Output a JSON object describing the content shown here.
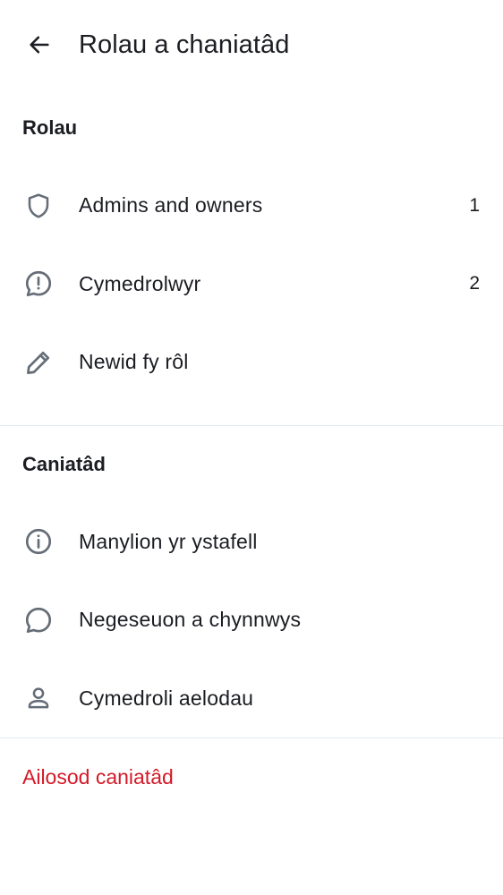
{
  "header": {
    "title": "Rolau a chaniatâd",
    "back_icon": "arrow-left-icon"
  },
  "roles_section": {
    "title": "Rolau",
    "items": [
      {
        "label": "Admins and owners",
        "count": "1",
        "icon": "shield-icon"
      },
      {
        "label": "Cymedrolwyr",
        "count": "2",
        "icon": "chat-alert-icon"
      },
      {
        "label": "Newid fy rôl",
        "count": "",
        "icon": "pencil-icon"
      }
    ]
  },
  "permissions_section": {
    "title": "Caniatâd",
    "items": [
      {
        "label": "Manylion yr ystafell",
        "icon": "info-icon"
      },
      {
        "label": "Negeseuon a chynnwys",
        "icon": "chat-bubble-icon"
      },
      {
        "label": "Cymedroli aelodau",
        "icon": "user-icon"
      }
    ]
  },
  "reset": {
    "label": "Ailosod caniatâd",
    "color": "#d51928"
  },
  "colors": {
    "text": "#1b1d22",
    "icon": "#656d77",
    "divider": "#e3e8f0",
    "danger": "#d51928"
  }
}
